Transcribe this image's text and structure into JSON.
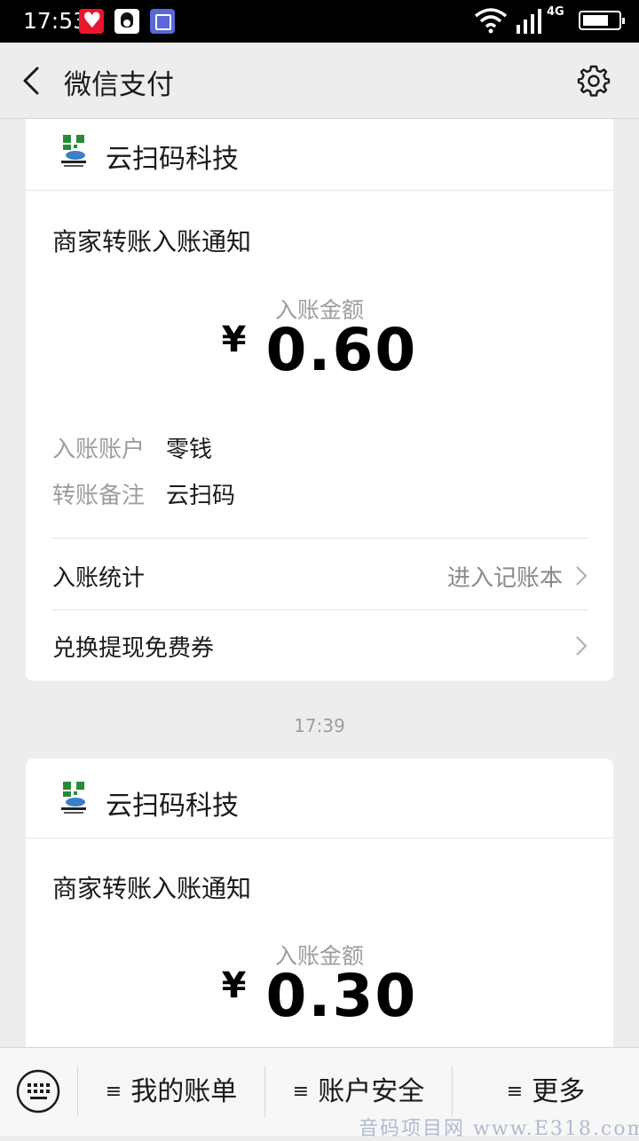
{
  "status_bar": {
    "time": "17:53",
    "network": "4G"
  },
  "header": {
    "title": "微信支付"
  },
  "messages": [
    {
      "merchant": "云扫码科技",
      "notice_title": "商家转账入账通知",
      "amount_label": "入账金额",
      "currency": "¥",
      "amount": "0.60",
      "details": [
        {
          "key": "入账账户",
          "value": "零钱"
        },
        {
          "key": "转账备注",
          "value": "云扫码"
        }
      ],
      "links": [
        {
          "label": "入账统计",
          "hint": "进入记账本"
        },
        {
          "label": "兑换提现免费券",
          "hint": ""
        }
      ]
    },
    {
      "timestamp": "17:39",
      "merchant": "云扫码科技",
      "notice_title": "商家转账入账通知",
      "amount_label": "入账金额",
      "currency": "¥",
      "amount": "0.30"
    }
  ],
  "bottom_menu": {
    "items": [
      {
        "label": "我的账单"
      },
      {
        "label": "账户安全"
      },
      {
        "label": "更多"
      }
    ]
  },
  "watermark": "音码项目网 www.E318.com"
}
